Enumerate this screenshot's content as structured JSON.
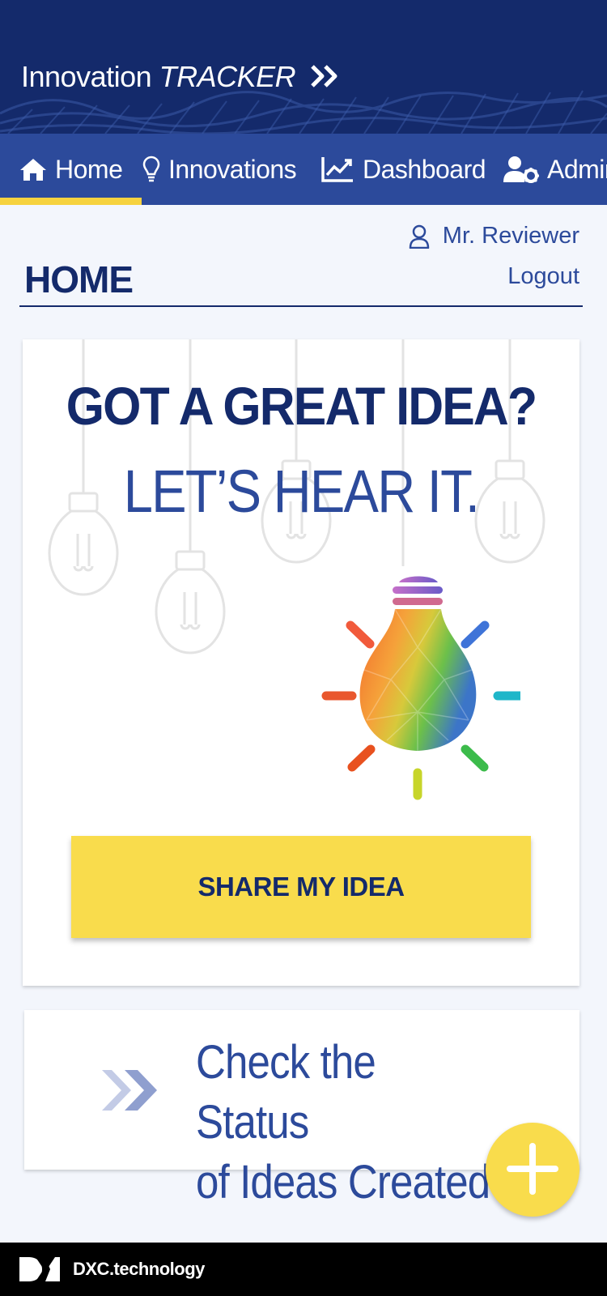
{
  "header": {
    "app_title_plain": "Innovation",
    "app_title_brand": "TRACKER",
    "chevron_icon": "double-chevron-right-icon"
  },
  "nav": {
    "items": [
      {
        "label": "Home",
        "icon": "home-icon",
        "active": true
      },
      {
        "label": "Innovations",
        "icon": "lightbulb-icon",
        "active": false
      },
      {
        "label": "Dashboard",
        "icon": "chart-line-icon",
        "active": false
      },
      {
        "label": "Admin",
        "icon": "user-cog-icon",
        "active": false
      }
    ]
  },
  "user": {
    "name": "Mr. Reviewer",
    "icon": "user-icon",
    "logout_label": "Logout"
  },
  "page": {
    "title": "HOME"
  },
  "hero": {
    "headline_1": "GOT A GREAT IDEA?",
    "headline_2": "LET’S HEAR IT.",
    "cta_label": "SHARE MY IDEA"
  },
  "status_card": {
    "line_1": "Check the Status",
    "line_2": "of Ideas Created"
  },
  "fab": {
    "icon": "plus-icon"
  },
  "footer": {
    "brand": "DXC.technology"
  },
  "colors": {
    "navy": "#142a6b",
    "blue": "#2c4a9b",
    "yellow": "#f9dc4c",
    "page_bg": "#f3f6fc"
  }
}
